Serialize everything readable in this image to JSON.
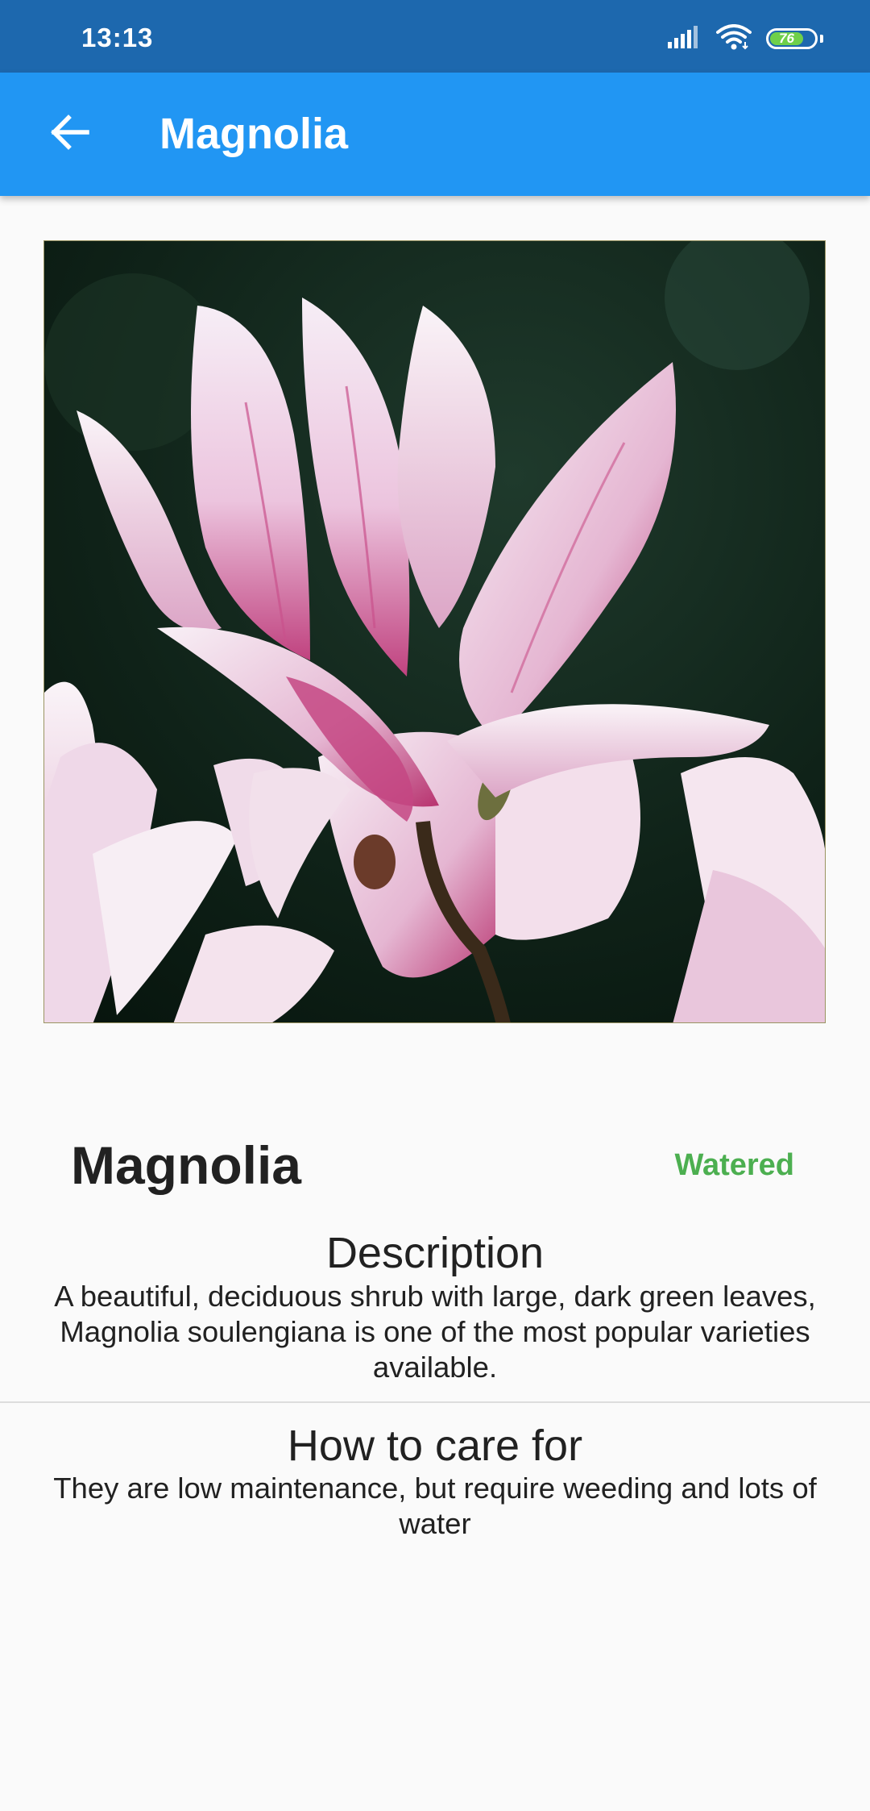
{
  "status_bar": {
    "time": "13:13",
    "battery_level": "76",
    "signal_icon": "signal-icon",
    "wifi_icon": "wifi-icon",
    "battery_icon": "battery-icon"
  },
  "app_bar": {
    "title": "Magnolia",
    "back_icon": "arrow-back-icon"
  },
  "plant": {
    "photo_subject": "pink magnolia flower",
    "name": "Magnolia",
    "status": "Watered",
    "status_color": "#4caf50"
  },
  "description": {
    "heading": "Description",
    "body": "A beautiful, deciduous shrub with large, dark green leaves, Magnolia soulengiana is one of the most popular varieties available."
  },
  "care": {
    "heading": "How to care for",
    "body": "They are low maintenance, but require weeding and lots of water"
  },
  "colors": {
    "status_bar": "#1d68ae",
    "app_bar": "#2196f3",
    "background": "#fafafa",
    "accent_green": "#4caf50"
  }
}
